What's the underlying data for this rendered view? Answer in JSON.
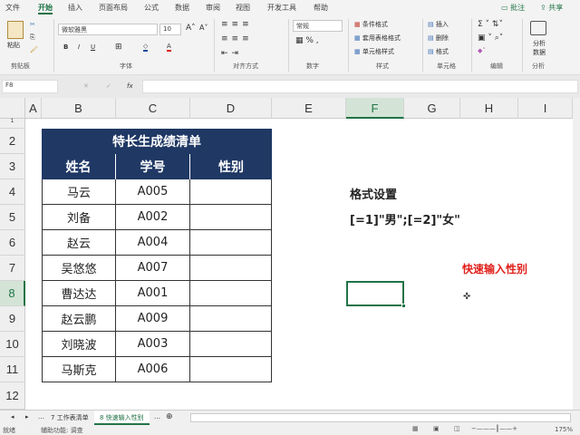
{
  "tabs": [
    "文件",
    "开始",
    "插入",
    "页面布局",
    "公式",
    "数据",
    "审阅",
    "视图",
    "开发工具",
    "帮助"
  ],
  "comment_btn": "批注",
  "share_btn": "共享",
  "ribbon": {
    "paste": "粘贴",
    "font_name": "微软雅黑",
    "font_size": "10",
    "number_format": "常规",
    "groups": [
      "剪贴板",
      "字体",
      "对齐方式",
      "数字",
      "样式",
      "单元格",
      "编辑",
      "分析"
    ],
    "cond_format": "条件格式",
    "table_format": "套用表格格式",
    "cell_style": "单元格样式",
    "insert": "插入",
    "delete": "删除",
    "format": "格式",
    "analyze": "分析数据"
  },
  "name_box": "F8",
  "formula": "",
  "columns": [
    "A",
    "B",
    "C",
    "D",
    "E",
    "F",
    "G",
    "H",
    "I"
  ],
  "rows": [
    "1",
    "2",
    "3",
    "4",
    "5",
    "6",
    "7",
    "8",
    "9",
    "10",
    "11",
    "12"
  ],
  "table": {
    "title": "特长生成绩清单",
    "headers": [
      "姓名",
      "学号",
      "性别"
    ],
    "data": [
      [
        "马云",
        "A005",
        ""
      ],
      [
        "刘备",
        "A002",
        ""
      ],
      [
        "赵云",
        "A004",
        ""
      ],
      [
        "吴悠悠",
        "A007",
        ""
      ],
      [
        "曹达达",
        "A001",
        ""
      ],
      [
        "赵云鹏",
        "A009",
        ""
      ],
      [
        "刘晓波",
        "A003",
        ""
      ],
      [
        "马斯克",
        "A006",
        ""
      ]
    ]
  },
  "notes": {
    "label": "格式设置",
    "format": "[=1]\"男\";[=2]\"女\"",
    "hint": "快速输入性别"
  },
  "sheets": [
    "7 工作表清单",
    "8 快速输入性别"
  ],
  "status": {
    "ready": "就绪",
    "accessibility": "辅助功能: 调查",
    "zoom": "175%"
  },
  "colors": {
    "header": "#1f3864",
    "accent": "#217346",
    "hint": "#e0201b"
  }
}
